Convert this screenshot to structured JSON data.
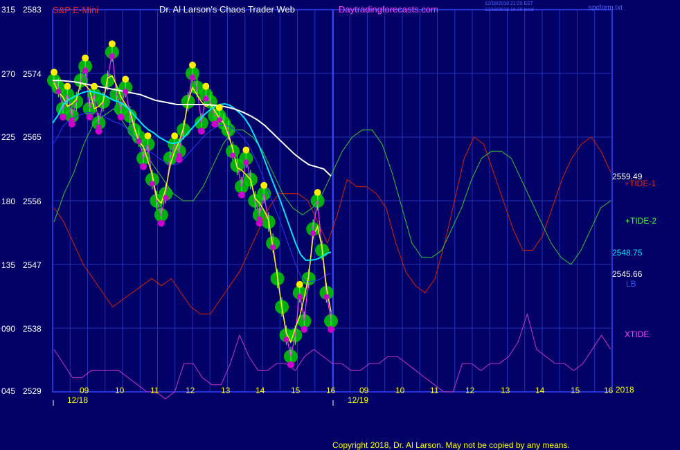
{
  "header": {
    "instrument": "S&P E-Mini",
    "site": "Dr. Al Larson's Chaos Trader Web",
    "url": "Daytradingforecasts.com",
    "stamp1": "12/18/2018 21:20 EST",
    "stamp2": "12/18/2018 16:20 local",
    "file": "spcform.txt"
  },
  "footer": {
    "copyright": "Copyright 2018, Dr. Al Larson. May not be copied by any means."
  },
  "colors": {
    "background": "#000066",
    "grid": "#2233bb",
    "frame": "#3344ff",
    "price": "#ffff00",
    "ma_fast": "#00e5ff",
    "ma_slow": "#ffffff",
    "tide1": "#dd2200",
    "tide2": "#33cc33",
    "xtide": "#cc33cc",
    "lb": "#3333ff",
    "dots_high": "#ffee00",
    "dots_low": "#cc00cc",
    "bands": "#00cc00"
  },
  "chart_data": {
    "type": "line",
    "title": "S&P E-Mini",
    "y_left_labels": [
      "315",
      "270",
      "225",
      "180",
      "135",
      "090",
      "045"
    ],
    "y_right_labels": [
      "2583",
      "2574",
      "2565",
      "2556",
      "2547",
      "2538",
      "2529"
    ],
    "ylim": [
      2529,
      2583
    ],
    "x_hour_labels": [
      "09",
      "10",
      "11",
      "12",
      "13",
      "14",
      "15",
      "16",
      "09",
      "10",
      "11",
      "12",
      "13",
      "14",
      "15",
      "16"
    ],
    "date_labels": [
      "12/18",
      "12/19"
    ],
    "year_label": "2018",
    "series_labels": [
      {
        "name": "+TIDE-1",
        "value": "2559.49"
      },
      {
        "name": "+TIDE-2",
        "value": ""
      },
      {
        "name": "",
        "value": "2548.75"
      },
      {
        "name": "LB",
        "value": "2545.66"
      },
      {
        "name": "XTIDE",
        "value": ""
      }
    ],
    "price": [
      2573,
      2572,
      2569,
      2571,
      2568,
      2570,
      2573,
      2575,
      2569,
      2571,
      2567,
      2570,
      2573,
      2577,
      2571,
      2569,
      2572,
      2568,
      2566,
      2565,
      2562,
      2564,
      2559,
      2556,
      2554,
      2557,
      2562,
      2564,
      2563,
      2566,
      2570,
      2574,
      2572,
      2567,
      2571,
      2570,
      2568,
      2568,
      2567,
      2566,
      2563,
      2561,
      2558,
      2562,
      2559,
      2556,
      2554,
      2557,
      2553,
      2550,
      2545,
      2541,
      2537,
      2534,
      2537,
      2543,
      2539,
      2545,
      2552,
      2556,
      2549,
      2543,
      2539
    ],
    "ma_fast": [
      2567,
      2568,
      2569.5,
      2570.2,
      2570.6,
      2571,
      2571.3,
      2571.5,
      2571.4,
      2571.2,
      2571,
      2570.6,
      2570.2,
      2570,
      2569.6,
      2569,
      2568.2,
      2567.4,
      2566.6,
      2566,
      2565.6,
      2565,
      2564.6,
      2564.2,
      2564.1,
      2564.3,
      2565,
      2565.8,
      2566.6,
      2567.4,
      2568.2,
      2568.8,
      2569.3,
      2569.6,
      2569.7,
      2569.5,
      2569,
      2568.4,
      2567.6,
      2566.5,
      2565,
      2563.4,
      2561.5,
      2559.6,
      2557.8,
      2556,
      2554,
      2552,
      2550,
      2548.4,
      2547.6,
      2547.6,
      2547.7,
      2548,
      2548.5,
      2548.75
    ],
    "ma_slow": [
      2573,
      2573,
      2572.9,
      2572.8,
      2572.6,
      2572.4,
      2572.2,
      2572,
      2571.8,
      2571.6,
      2571.4,
      2571.2,
      2571,
      2570.6,
      2570.2,
      2570,
      2569.8,
      2569.6,
      2569.6,
      2569.6,
      2569.6,
      2569.6,
      2569.5,
      2569.4,
      2569.2,
      2568.9,
      2568.5,
      2568,
      2567.4,
      2566.6,
      2565.6,
      2564.6,
      2563.6,
      2562.6,
      2561.8,
      2561.1,
      2560.8,
      2560.5,
      2559.49
    ],
    "tide1": [
      2555,
      2553,
      2550,
      2547,
      2545,
      2543,
      2541,
      2542,
      2543,
      2544,
      2545,
      2544,
      2545,
      2543,
      2541,
      2540,
      2540,
      2542,
      2544,
      2546,
      2549,
      2552,
      2555,
      2557,
      2557,
      2557,
      2556,
      2553,
      2550,
      2554,
      2559,
      2558,
      2558,
      2557,
      2555,
      2550,
      2546,
      2544,
      2543,
      2545,
      2550,
      2556,
      2562,
      2565,
      2564,
      2560,
      2556,
      2552,
      2549,
      2549,
      2551,
      2555,
      2559,
      2562,
      2564,
      2565,
      2563,
      2560
    ],
    "tide2": [
      2553,
      2557,
      2560,
      2564,
      2567,
      2568,
      2569,
      2567,
      2565,
      2563,
      2561,
      2559,
      2557,
      2556,
      2556,
      2558,
      2561,
      2564,
      2566,
      2566,
      2565,
      2563,
      2560,
      2557,
      2555,
      2554,
      2555,
      2557,
      2560,
      2563,
      2565,
      2566,
      2566,
      2564,
      2560,
      2555,
      2550,
      2548,
      2548,
      2549,
      2552,
      2555,
      2559,
      2562,
      2563,
      2563,
      2562,
      2559,
      2556,
      2553,
      2550,
      2548,
      2547,
      2549,
      2552,
      2555,
      2556
    ],
    "xtide": [
      2535,
      2533,
      2531,
      2531,
      2532,
      2532,
      2532,
      2532,
      2531,
      2530,
      2529,
      2529,
      2528,
      2529,
      2533,
      2533,
      2531,
      2530,
      2530,
      2533,
      2537,
      2534,
      2532,
      2532,
      2533,
      2533,
      2532,
      2534,
      2535,
      2534,
      2533,
      2533,
      2532,
      2532,
      2533,
      2533,
      2534,
      2534,
      2533,
      2532,
      2531,
      2530,
      2529,
      2529,
      2533,
      2533,
      2532,
      2533,
      2533,
      2534,
      2536,
      2540,
      2535,
      2534,
      2533,
      2533,
      2532,
      2533,
      2535,
      2537,
      2535
    ]
  }
}
